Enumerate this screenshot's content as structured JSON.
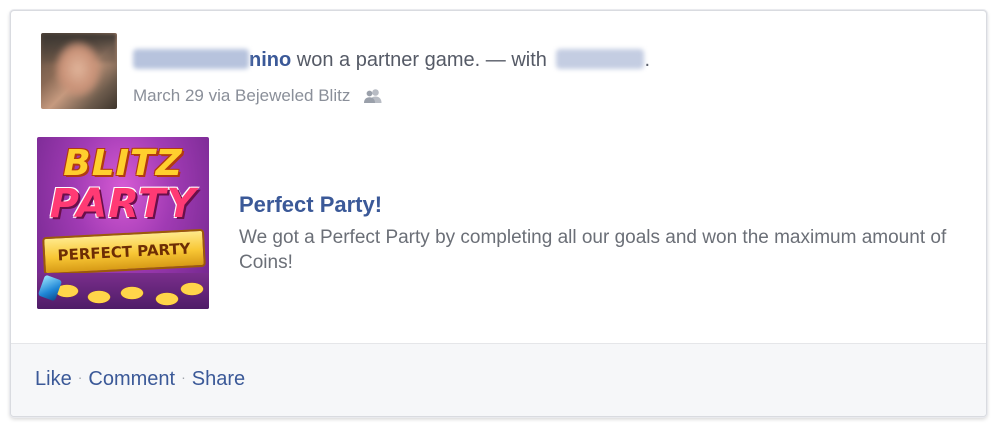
{
  "post": {
    "actor_name_visible": "nino",
    "action_text": " won a partner game. — with ",
    "end_punct": ".",
    "timestamp": "March 29",
    "via_text": " via Bejeweled Blitz"
  },
  "attachment": {
    "thumb": {
      "word1": "BLITZ",
      "word2": "PARTY",
      "banner": "PERFECT PARTY"
    },
    "title": "Perfect Party!",
    "description": "We got a Perfect Party by completing all our goals and won the maximum amount of Coins!"
  },
  "actions": {
    "like": "Like",
    "comment": "Comment",
    "share": "Share",
    "separator": "·"
  },
  "colors": {
    "link": "#3b5998",
    "meta": "#8a8f99",
    "body_text": "#6b6f77",
    "footer_bg": "#f6f7f9"
  },
  "icons": {
    "audience": "friends-icon"
  }
}
